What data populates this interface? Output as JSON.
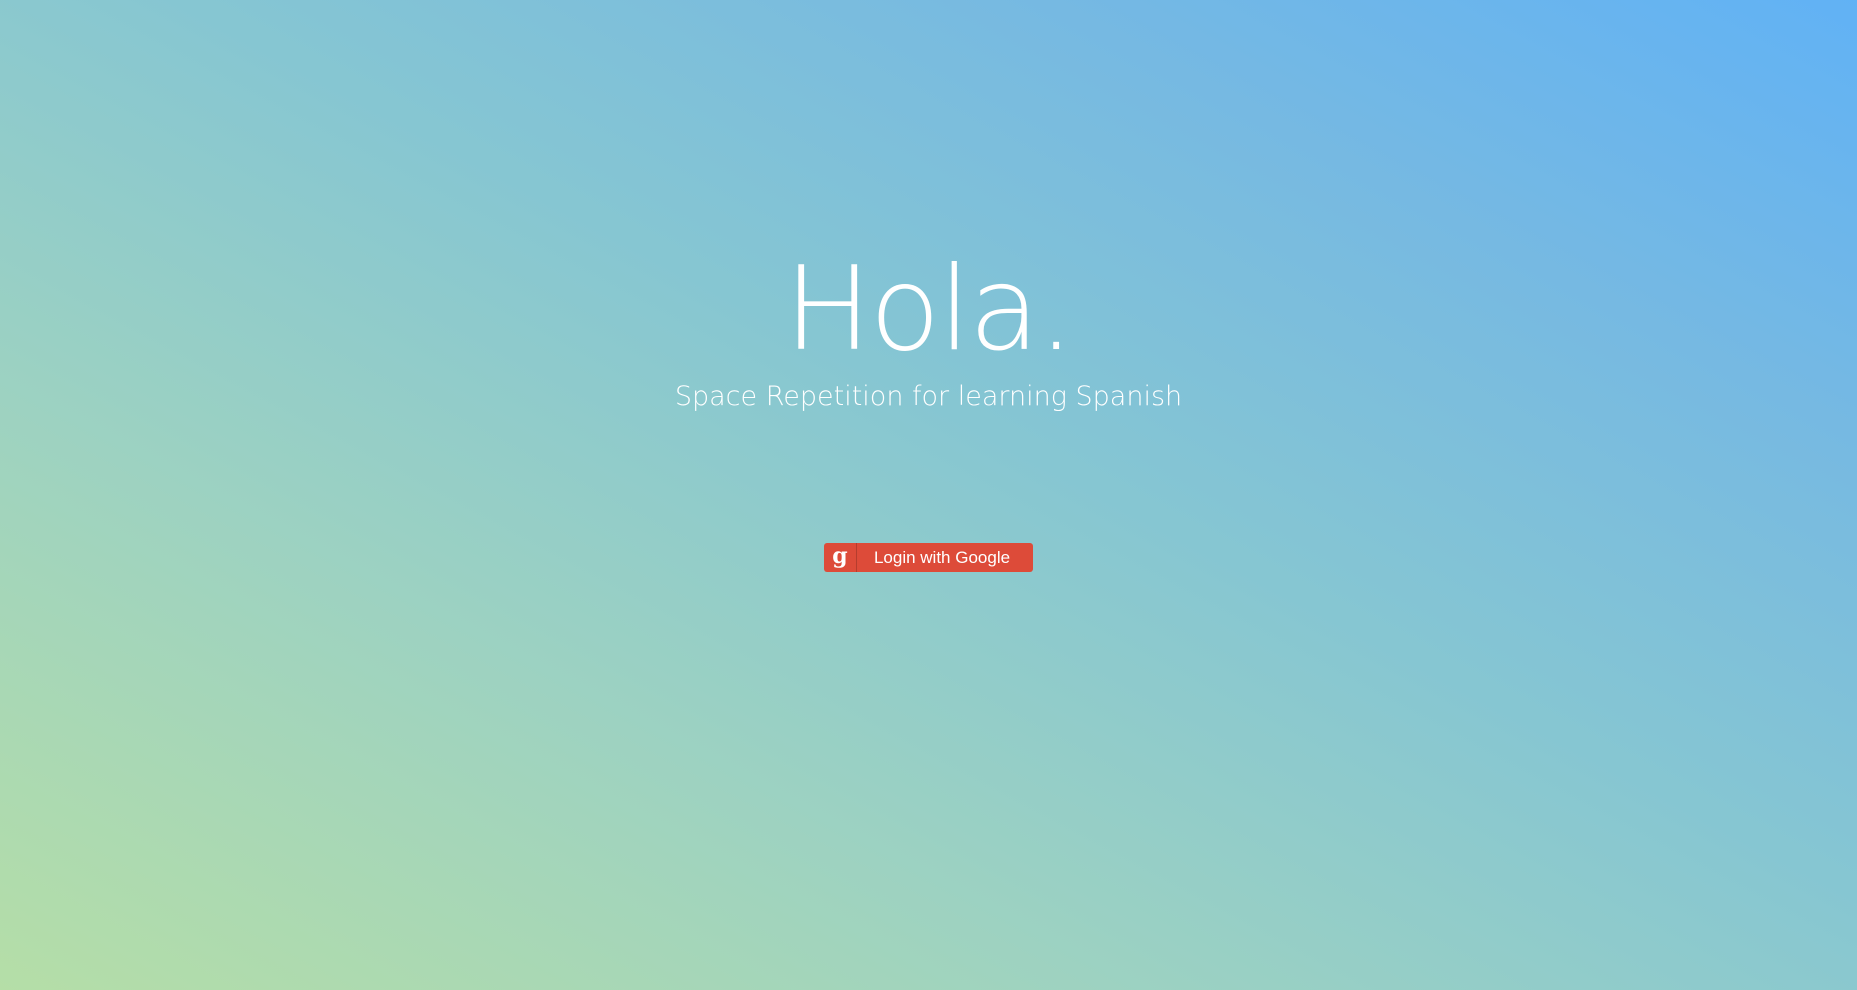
{
  "hero": {
    "title": "Hola.",
    "subtitle": "Space Repetition for learning Spanish"
  },
  "login": {
    "label": "Login with Google",
    "icon_glyph": "g",
    "icon": "google-plus-icon",
    "color": "#dd4b39"
  },
  "colors": {
    "background_gradient_start": "#b5dea7",
    "background_gradient_end": "#61b2f5",
    "text": "#ffffff"
  }
}
